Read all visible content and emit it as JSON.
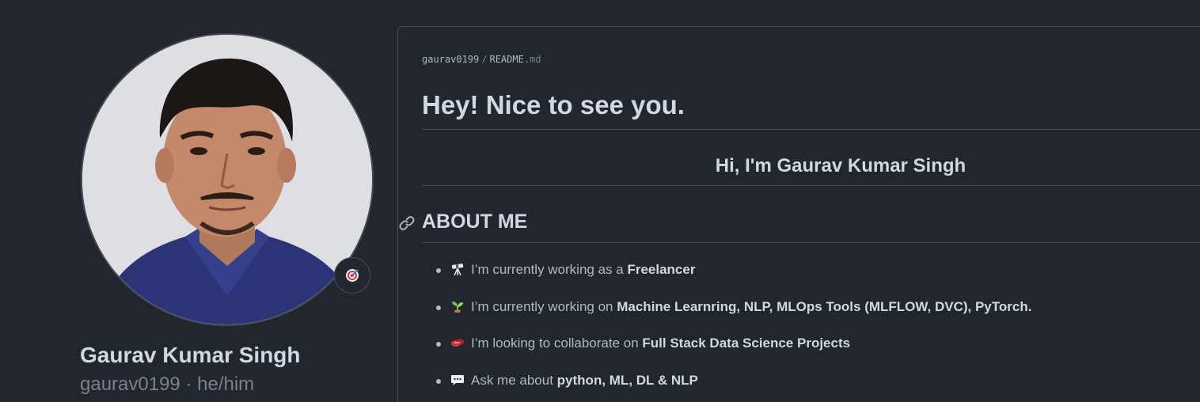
{
  "profile": {
    "name": "Gaurav Kumar Singh",
    "login": "gaurav0199",
    "separator": "·",
    "pronouns": "he/him",
    "status_icon": "target-icon"
  },
  "readme": {
    "path_user": "gaurav0199",
    "path_sep": "/",
    "path_file": "README",
    "path_ext": ".md",
    "heading": "Hey! Nice to see you.",
    "greeting": "Hi, I'm Gaurav Kumar Singh",
    "about_heading": "ABOUT ME",
    "about_items": [
      {
        "icon": "telescope-icon",
        "text": "I’m currently working as a ",
        "strong": "Freelancer"
      },
      {
        "icon": "seedling-icon",
        "text": "I’m currently working on ",
        "strong": "Machine Learnring, NLP, MLOps Tools (MLFLOW, DVC), PyTorch."
      },
      {
        "icon": "handshake-icon",
        "text": "I’m looking to collaborate on ",
        "strong": "Full Stack Data Science Projects"
      },
      {
        "icon": "speech-bubble-icon",
        "text": "Ask me about ",
        "strong": "python, ML, DL & NLP"
      }
    ]
  },
  "colors": {
    "background": "#22272e",
    "border": "#444c56",
    "text": "#adbac7",
    "heading": "#cdd9e5",
    "muted": "#768390"
  }
}
